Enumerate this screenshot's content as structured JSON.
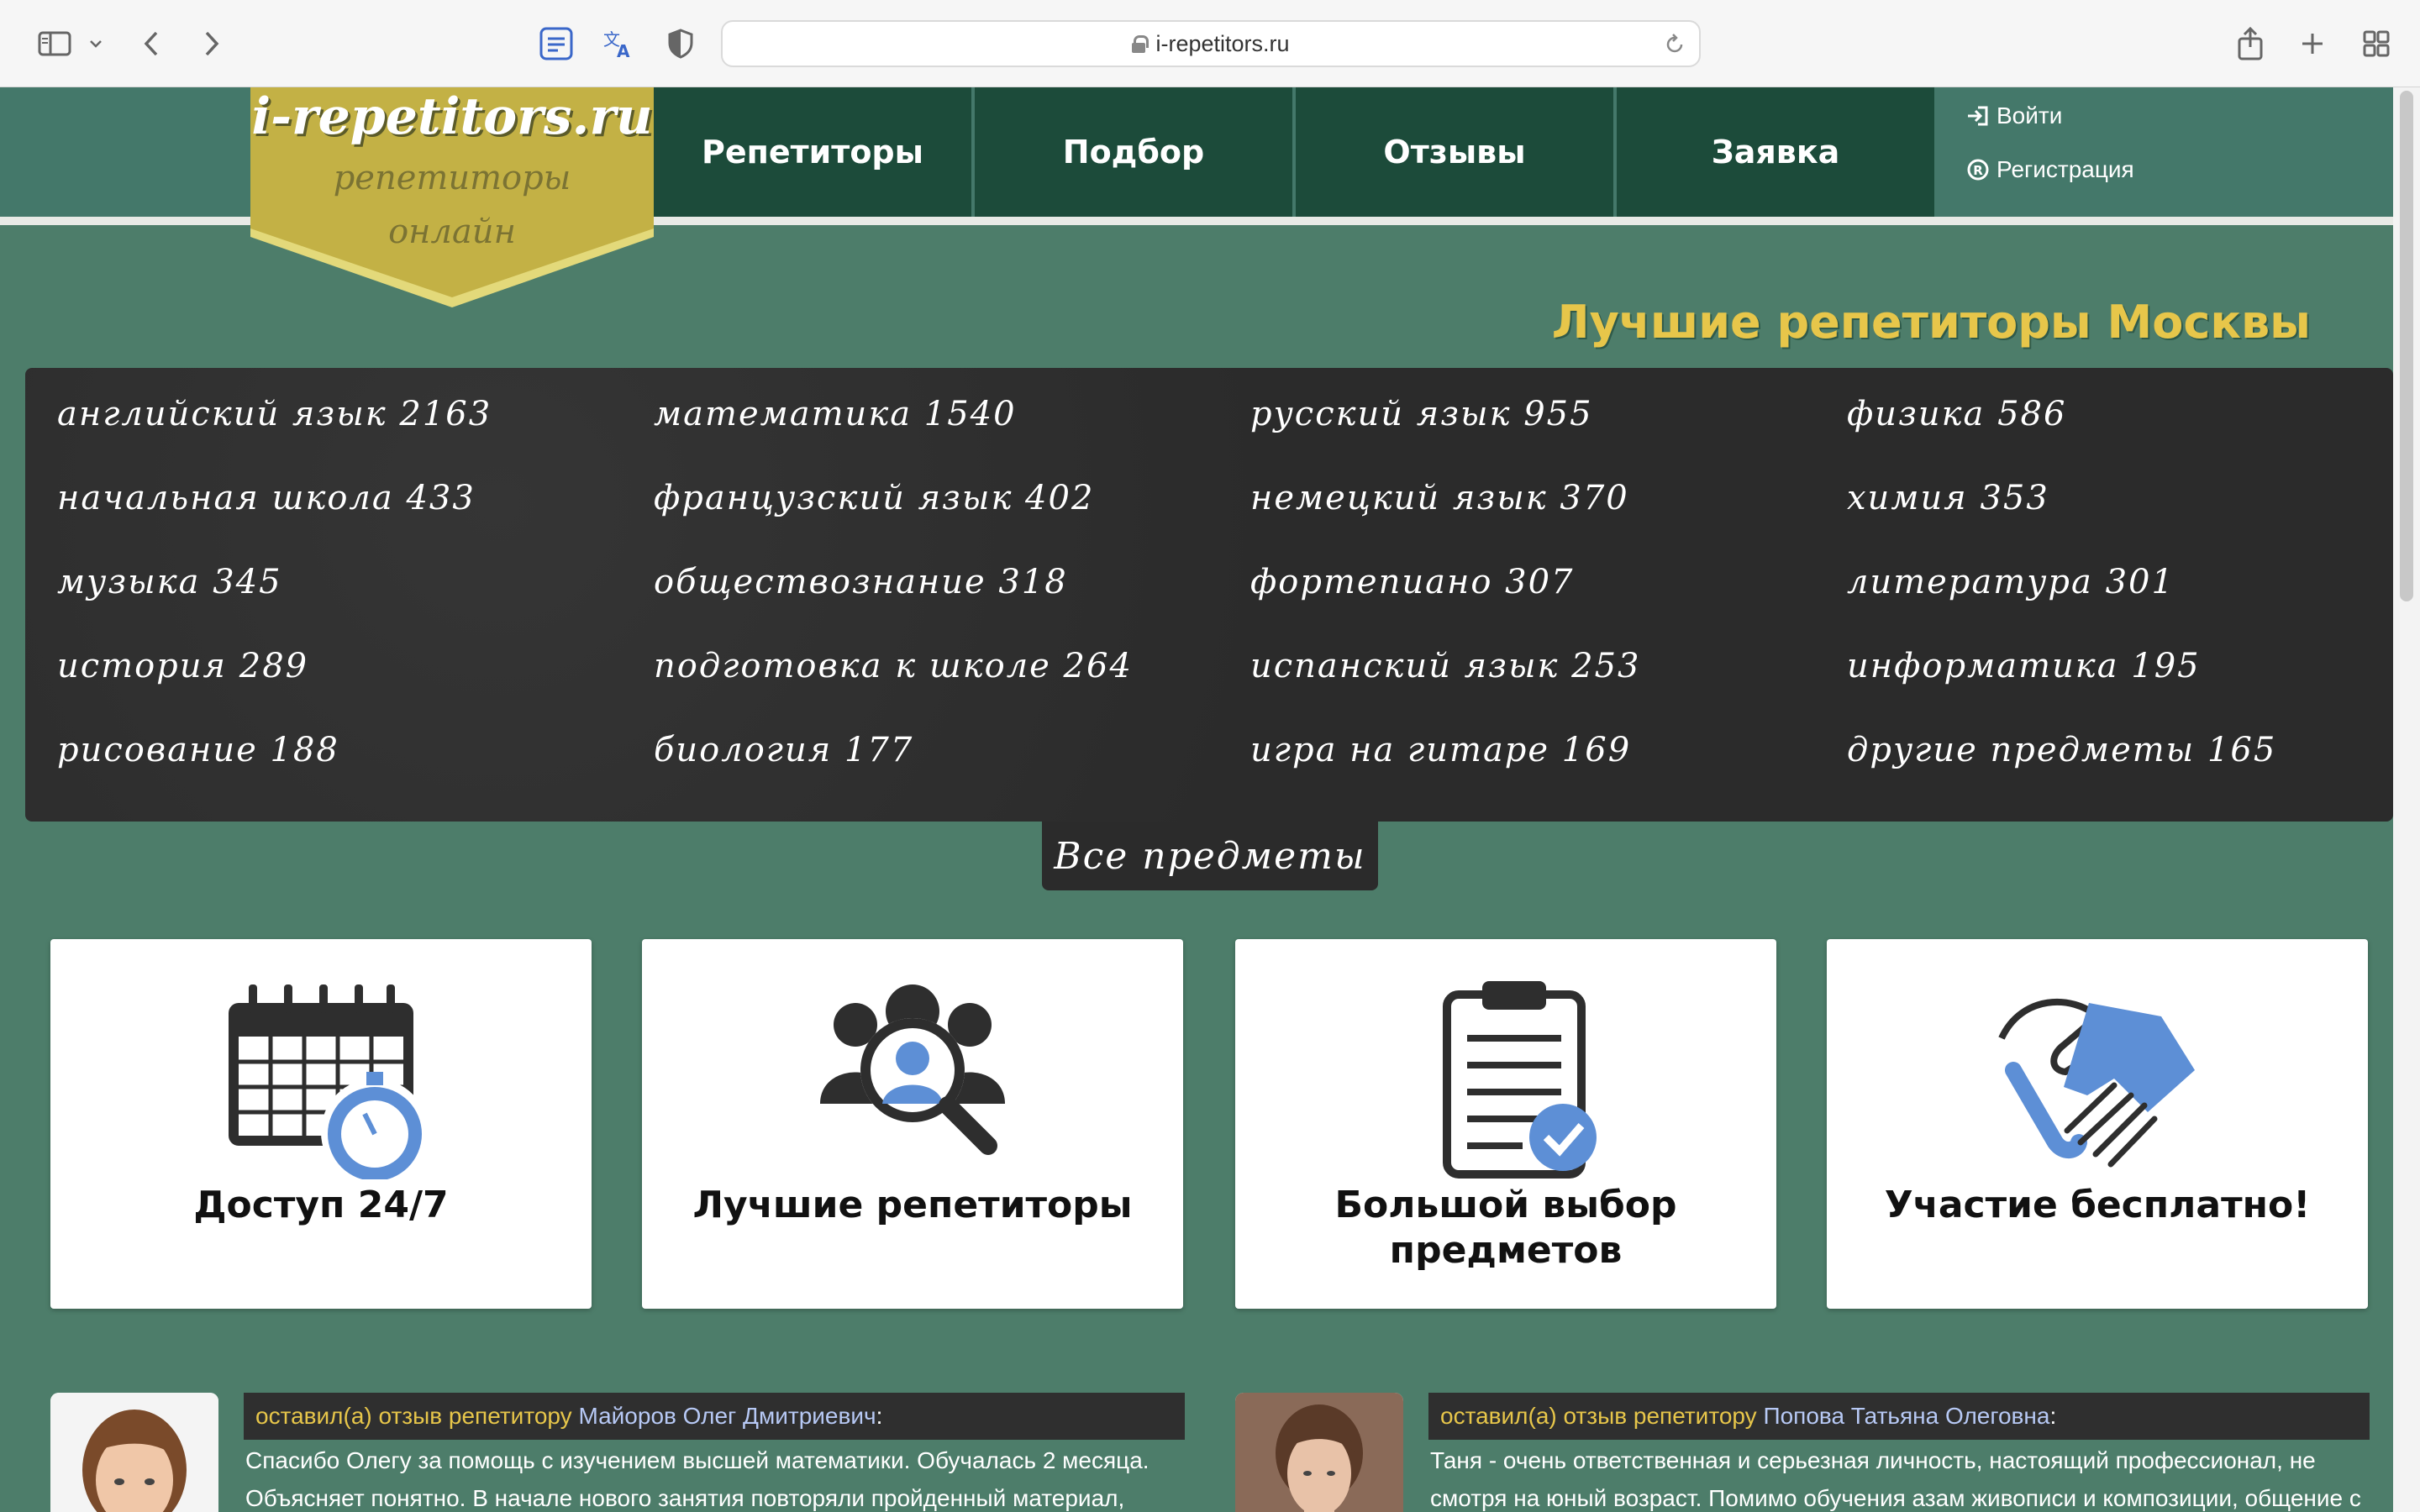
{
  "browser": {
    "url": "i-repetitors.ru"
  },
  "site": {
    "logo_title": "i-repetitors.ru",
    "logo_sub1": "репетиторы",
    "logo_sub2": "онлайн",
    "nav": [
      "Репетиторы",
      "Подбор",
      "Отзывы",
      "Заявка"
    ],
    "login": "Войти",
    "register": "Регистрация"
  },
  "headline": "Лучшие репетиторы Москвы",
  "subjects": [
    "английский язык 2163",
    "математика 1540",
    "русский язык 955",
    "физика 586",
    "начальная школа 433",
    "французский язык 402",
    "немецкий язык 370",
    "химия 353",
    "музыка 345",
    "обществознание 318",
    "фортепиано 307",
    "литература 301",
    "история 289",
    "подготовка к школе 264",
    "испанский язык 253",
    "информатика 195",
    "рисование 188",
    "биология 177",
    "игра на гитаре 169",
    "другие предметы 165"
  ],
  "all_subjects": "Все предметы",
  "features": [
    {
      "title": "Доступ 24/7",
      "icon": "calendar-stopwatch-icon"
    },
    {
      "title": "Лучшие репетиторы",
      "icon": "people-magnifier-icon"
    },
    {
      "title": "Большой выбор предметов",
      "icon": "clipboard-check-icon"
    },
    {
      "title": "Участие бесплатно!",
      "icon": "handshake-icon"
    }
  ],
  "reviews": [
    {
      "prefix": "оставил(а) отзыв репетитору",
      "tutor": "Майоров Олег Дмитриевич",
      "text": "Спасибо Олегу за помощь с изучением высшей математики. Обучалась 2 месяца. Объясняет понятно. В начале нового занятия повторяли пройденный материал,"
    },
    {
      "prefix": "оставил(а) отзыв репетитору",
      "tutor": "Попова Татьяна Олеговна",
      "text": "Таня - очень ответственная и серьезная личность, настоящий профессионал, не смотря на юный возраст. Помимо обучения азам живописи и композиции, общение с"
    }
  ],
  "colors": {
    "page_bg": "#4d7d6a",
    "nav_bg": "#1c4b3a",
    "logo_gold": "#c3b145",
    "headline": "#e7c64a",
    "board": "#2b2b2b",
    "icon_blue": "#5d8fd6"
  }
}
